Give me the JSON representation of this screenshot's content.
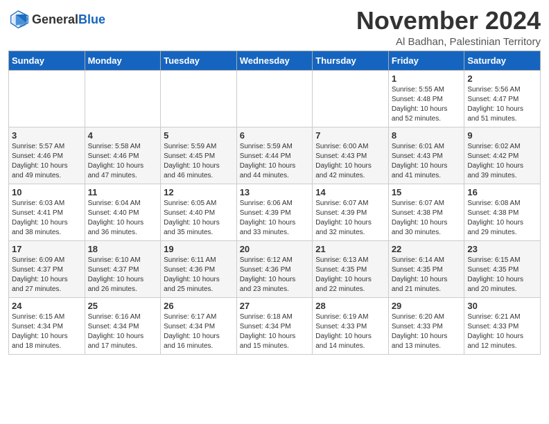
{
  "header": {
    "logo_line1": "General",
    "logo_line2": "Blue",
    "month": "November 2024",
    "location": "Al Badhan, Palestinian Territory"
  },
  "days_of_week": [
    "Sunday",
    "Monday",
    "Tuesday",
    "Wednesday",
    "Thursday",
    "Friday",
    "Saturday"
  ],
  "weeks": [
    [
      {
        "day": "",
        "info": ""
      },
      {
        "day": "",
        "info": ""
      },
      {
        "day": "",
        "info": ""
      },
      {
        "day": "",
        "info": ""
      },
      {
        "day": "",
        "info": ""
      },
      {
        "day": "1",
        "info": "Sunrise: 5:55 AM\nSunset: 4:48 PM\nDaylight: 10 hours\nand 52 minutes."
      },
      {
        "day": "2",
        "info": "Sunrise: 5:56 AM\nSunset: 4:47 PM\nDaylight: 10 hours\nand 51 minutes."
      }
    ],
    [
      {
        "day": "3",
        "info": "Sunrise: 5:57 AM\nSunset: 4:46 PM\nDaylight: 10 hours\nand 49 minutes."
      },
      {
        "day": "4",
        "info": "Sunrise: 5:58 AM\nSunset: 4:46 PM\nDaylight: 10 hours\nand 47 minutes."
      },
      {
        "day": "5",
        "info": "Sunrise: 5:59 AM\nSunset: 4:45 PM\nDaylight: 10 hours\nand 46 minutes."
      },
      {
        "day": "6",
        "info": "Sunrise: 5:59 AM\nSunset: 4:44 PM\nDaylight: 10 hours\nand 44 minutes."
      },
      {
        "day": "7",
        "info": "Sunrise: 6:00 AM\nSunset: 4:43 PM\nDaylight: 10 hours\nand 42 minutes."
      },
      {
        "day": "8",
        "info": "Sunrise: 6:01 AM\nSunset: 4:43 PM\nDaylight: 10 hours\nand 41 minutes."
      },
      {
        "day": "9",
        "info": "Sunrise: 6:02 AM\nSunset: 4:42 PM\nDaylight: 10 hours\nand 39 minutes."
      }
    ],
    [
      {
        "day": "10",
        "info": "Sunrise: 6:03 AM\nSunset: 4:41 PM\nDaylight: 10 hours\nand 38 minutes."
      },
      {
        "day": "11",
        "info": "Sunrise: 6:04 AM\nSunset: 4:40 PM\nDaylight: 10 hours\nand 36 minutes."
      },
      {
        "day": "12",
        "info": "Sunrise: 6:05 AM\nSunset: 4:40 PM\nDaylight: 10 hours\nand 35 minutes."
      },
      {
        "day": "13",
        "info": "Sunrise: 6:06 AM\nSunset: 4:39 PM\nDaylight: 10 hours\nand 33 minutes."
      },
      {
        "day": "14",
        "info": "Sunrise: 6:07 AM\nSunset: 4:39 PM\nDaylight: 10 hours\nand 32 minutes."
      },
      {
        "day": "15",
        "info": "Sunrise: 6:07 AM\nSunset: 4:38 PM\nDaylight: 10 hours\nand 30 minutes."
      },
      {
        "day": "16",
        "info": "Sunrise: 6:08 AM\nSunset: 4:38 PM\nDaylight: 10 hours\nand 29 minutes."
      }
    ],
    [
      {
        "day": "17",
        "info": "Sunrise: 6:09 AM\nSunset: 4:37 PM\nDaylight: 10 hours\nand 27 minutes."
      },
      {
        "day": "18",
        "info": "Sunrise: 6:10 AM\nSunset: 4:37 PM\nDaylight: 10 hours\nand 26 minutes."
      },
      {
        "day": "19",
        "info": "Sunrise: 6:11 AM\nSunset: 4:36 PM\nDaylight: 10 hours\nand 25 minutes."
      },
      {
        "day": "20",
        "info": "Sunrise: 6:12 AM\nSunset: 4:36 PM\nDaylight: 10 hours\nand 23 minutes."
      },
      {
        "day": "21",
        "info": "Sunrise: 6:13 AM\nSunset: 4:35 PM\nDaylight: 10 hours\nand 22 minutes."
      },
      {
        "day": "22",
        "info": "Sunrise: 6:14 AM\nSunset: 4:35 PM\nDaylight: 10 hours\nand 21 minutes."
      },
      {
        "day": "23",
        "info": "Sunrise: 6:15 AM\nSunset: 4:35 PM\nDaylight: 10 hours\nand 20 minutes."
      }
    ],
    [
      {
        "day": "24",
        "info": "Sunrise: 6:15 AM\nSunset: 4:34 PM\nDaylight: 10 hours\nand 18 minutes."
      },
      {
        "day": "25",
        "info": "Sunrise: 6:16 AM\nSunset: 4:34 PM\nDaylight: 10 hours\nand 17 minutes."
      },
      {
        "day": "26",
        "info": "Sunrise: 6:17 AM\nSunset: 4:34 PM\nDaylight: 10 hours\nand 16 minutes."
      },
      {
        "day": "27",
        "info": "Sunrise: 6:18 AM\nSunset: 4:34 PM\nDaylight: 10 hours\nand 15 minutes."
      },
      {
        "day": "28",
        "info": "Sunrise: 6:19 AM\nSunset: 4:33 PM\nDaylight: 10 hours\nand 14 minutes."
      },
      {
        "day": "29",
        "info": "Sunrise: 6:20 AM\nSunset: 4:33 PM\nDaylight: 10 hours\nand 13 minutes."
      },
      {
        "day": "30",
        "info": "Sunrise: 6:21 AM\nSunset: 4:33 PM\nDaylight: 10 hours\nand 12 minutes."
      }
    ]
  ]
}
